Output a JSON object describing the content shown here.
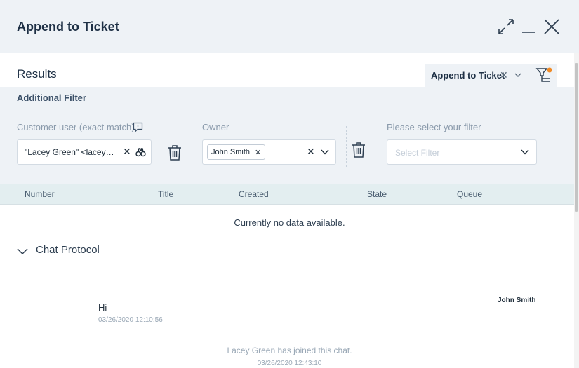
{
  "dialog": {
    "title": "Append to Ticket"
  },
  "results": {
    "title": "Results",
    "tab_label": "Append to Ticket"
  },
  "filter": {
    "heading": "Additional Filter",
    "customer_label": "Customer user (exact match)",
    "customer_value": "\"Lacey Green\" <lacey…",
    "owner_label": "Owner",
    "owner_chip": "John Smith",
    "select_label": "Please select your filter",
    "select_placeholder": "Select Filter"
  },
  "table": {
    "columns": [
      "Number",
      "Title",
      "Created",
      "State",
      "Queue"
    ],
    "empty_message": "Currently no data available."
  },
  "chat": {
    "title": "Chat Protocol",
    "sender": "John Smith",
    "message": "Hi",
    "message_time": "03/26/2020 12:10:56",
    "system_message": "Lacey Green has joined this chat.",
    "system_time": "03/26/2020 12:43:10"
  },
  "colors": {
    "header_bg": "#eef2f6",
    "accent_badge": "#f08a24",
    "table_header_bg": "#e3eef0"
  }
}
